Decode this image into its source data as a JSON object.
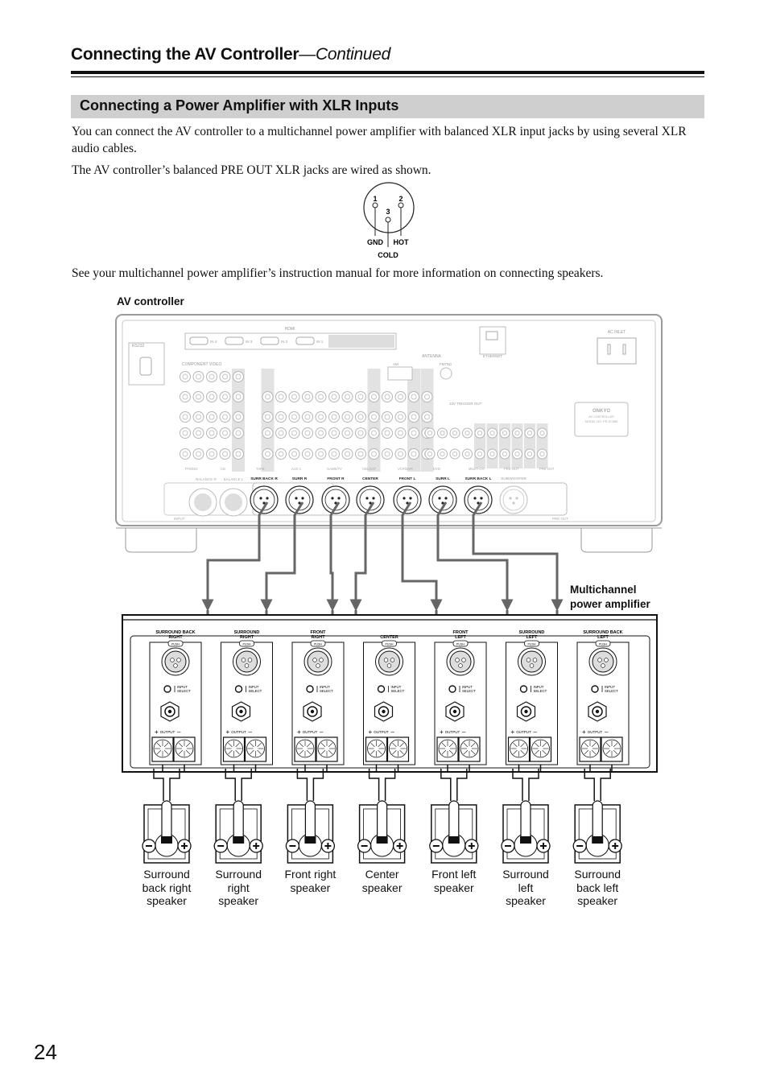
{
  "header": {
    "title": "Connecting the AV Controller",
    "title_suffix": "—Continued"
  },
  "section": {
    "title": "Connecting a Power Amplifier with XLR Inputs"
  },
  "body": {
    "paragraph_1": "You can connect the AV controller to a multichannel power amplifier with balanced XLR input jacks by using several XLR audio cables.",
    "paragraph_2": "The AV controller’s balanced PRE OUT XLR jacks are wired as shown.",
    "paragraph_3": "See your multichannel power amplifier’s instruction manual for more information on connecting speakers."
  },
  "xlr_pinout": {
    "pins": [
      {
        "number": "1",
        "signal": "GND"
      },
      {
        "number": "2",
        "signal": "HOT"
      },
      {
        "number": "3",
        "signal": "COLD"
      }
    ]
  },
  "diagram": {
    "av_controller_label": "AV controller",
    "amplifier_label_line1": "Multichannel",
    "amplifier_label_line2": "power amplifier",
    "controller_panel": {
      "rs232": "RS232",
      "hdmi": "HDMI",
      "hdmi_inputs": [
        "IN 4",
        "IN 3",
        "IN 2",
        "IN 1"
      ],
      "component_video": "COMPONENT VIDEO",
      "antenna": "ANTENNA",
      "am": "AM",
      "fm": "FM75Ω",
      "ethernet": "ETHERNET",
      "ac_inlet": "AC INLET",
      "trigger": "12V TRIGGER OUT",
      "brand": "ONKYO",
      "model_line1": "AV CONTROLLER",
      "model_line2": "MODEL NO. PR-SC886",
      "audio_groups": [
        "PHONO",
        "CD",
        "TAPE",
        "AUX 1",
        "GAME/TV",
        "CBL/SAT",
        "VCR/DVR",
        "DVD",
        "MULTI CH",
        "PRE OUT",
        "PRE OUT"
      ],
      "input_section": "INPUT",
      "balance_inputs": [
        "BALANCE R",
        "BALANCE L"
      ],
      "pre_out_section": "PRE OUT",
      "xlr_outputs": [
        "SURR BACK R",
        "SURR R",
        "FRONT R",
        "CENTER",
        "FRONT L",
        "SURR L",
        "SURR BACK L",
        "SUBWOOFER"
      ]
    },
    "amplifier_channels": [
      {
        "line1": "SURROUND BACK",
        "line2": "RIGHT",
        "speaker": "Surround back right speaker"
      },
      {
        "line1": "SURROUND",
        "line2": "RIGHT",
        "speaker": "Surround right speaker"
      },
      {
        "line1": "FRONT",
        "line2": "RIGHT",
        "speaker": "Front right speaker"
      },
      {
        "line1": "",
        "line2": "CENTER",
        "speaker": "Center speaker"
      },
      {
        "line1": "FRONT",
        "line2": "LEFT",
        "speaker": "Front left speaker"
      },
      {
        "line1": "SURROUND",
        "line2": "LEFT",
        "speaker": "Surround left speaker"
      },
      {
        "line1": "SURROUND BACK",
        "line2": "LEFT",
        "speaker": "Surround back left speaker"
      }
    ],
    "channel_controls": {
      "push": "PUSH",
      "input_select_1": "INPUT",
      "input_select_2": "SELECT",
      "output": "OUTPUT",
      "plus": "+",
      "minus": "–"
    },
    "speaker_labels": [
      [
        "Surround",
        "back right",
        "speaker"
      ],
      [
        "Surround",
        "right",
        "speaker"
      ],
      [
        "Front right",
        "speaker"
      ],
      [
        "Center",
        "speaker"
      ],
      [
        "Front left",
        "speaker"
      ],
      [
        "Surround",
        "left",
        "speaker"
      ],
      [
        "Surround",
        "back left",
        "speaker"
      ]
    ]
  },
  "footer": {
    "page_number": "24"
  }
}
